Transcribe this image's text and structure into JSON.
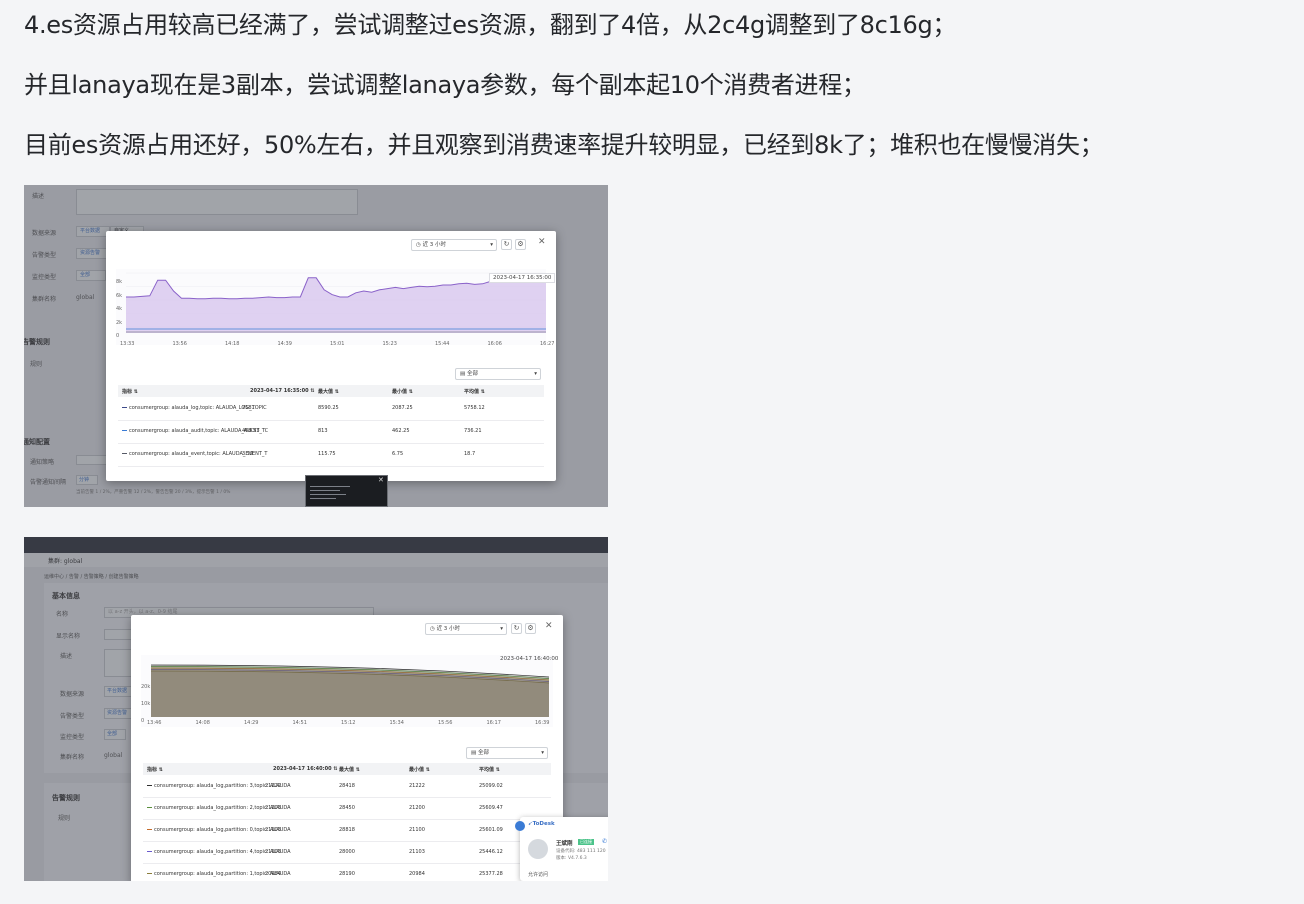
{
  "paragraphs": {
    "p1": "4.es资源占用较高已经满了，尝试调整过es资源，翻到了4倍，从2c4g调整到了8c16g；",
    "p2": "并且lanaya现在是3副本，尝试调整lanaya参数，每个副本起10个消费者进程；",
    "p3": "目前es资源占用还好，50%左右，并且观察到消费速率提升较明显，已经到8k了；堆积也在慢慢消失；"
  },
  "shot1": {
    "background_form": {
      "labels": [
        "描述",
        "数据来源",
        "告警类型",
        "监控类型",
        "集群名称"
      ],
      "values": [
        "平台数据",
        "自定义",
        "资源告警",
        "全部",
        "global"
      ],
      "section_rules": "告警规则",
      "section_rules_sub": "规则",
      "section_notify": "通知配置",
      "notify_labels": [
        "通知策略",
        "告警通知间隔"
      ],
      "notify_value": "分钟",
      "footer_note": "当前告警 1 / 2%，严重告警 12 / 2%，警告告警 20 / 3%，提示告警 1 / 0%"
    },
    "modal": {
      "time_range": "近 3 小时",
      "datetime_tag": "2023-04-17 16:35:00",
      "y_ticks": [
        "8k",
        "6k",
        "4k",
        "2k",
        "0"
      ],
      "x_ticks": [
        "13:33",
        "13:56",
        "14:18",
        "14:39",
        "15:01",
        "15:23",
        "15:44",
        "16:06",
        "16:27"
      ],
      "filter_label": "全部",
      "columns": [
        "指标",
        "2023-04-17 16:35:00",
        "最大值",
        "最小值",
        "平均值"
      ],
      "rows": [
        {
          "metric": "consumergroup: alauda_log,topic: ALAUDA_LOG_TOPIC",
          "current": "7581",
          "max": "8590.25",
          "min": "2087.25",
          "avg": "5758.12",
          "color": "#3c4a8a"
        },
        {
          "metric": "consumergroup: alauda_audit,topic: ALAUDA_AUDIT_TC",
          "current": "468.53",
          "max": "813",
          "min": "462.25",
          "avg": "736.21",
          "color": "#3a7bd5"
        },
        {
          "metric": "consumergroup: alauda_event,topic: ALAUDA_EVENT_T",
          "current": "3.19",
          "max": "115.75",
          "min": "6.75",
          "avg": "18.7",
          "color": "#555a66"
        }
      ],
      "colors": {
        "series_primary": "#8a62c9",
        "series_fill": "#d9c9ef",
        "series_secondary": "#3a7bd5"
      }
    }
  },
  "shot2": {
    "topbar": {
      "project": "集群: global"
    },
    "breadcrumb": "运维中心 / 告警 / 告警策略 / 创建告警策略",
    "background_form": {
      "section_basic": "基本信息",
      "labels": [
        "名称",
        "显示名称",
        "描述",
        "数据来源",
        "告警类型",
        "监控类型",
        "集群名称"
      ],
      "name_placeholder": "以 a-z 开头，以 a-z、0-9 结尾",
      "values": [
        "平台数据",
        "资源告警",
        "全部",
        "global"
      ],
      "section_rules": "告警规则",
      "section_rules_sub": "规则"
    },
    "modal": {
      "time_range": "近 3 小时",
      "datetime_tag": "2023-04-17 16:40:00",
      "y_ticks": [
        "20k",
        "10k",
        "0"
      ],
      "x_ticks": [
        "13:46",
        "14:08",
        "14:29",
        "14:51",
        "15:12",
        "15:34",
        "15:56",
        "16:17",
        "16:39"
      ],
      "filter_label": "全部",
      "columns": [
        "指标",
        "2023-04-17 16:40:00",
        "最大值",
        "最小值",
        "平均值"
      ],
      "rows": [
        {
          "metric": "consumergroup: alauda_log,partition: 3,topic: ALAUDA",
          "current": "21222",
          "max": "28418",
          "min": "21222",
          "avg": "25099.02",
          "color": "#2f2f2f"
        },
        {
          "metric": "consumergroup: alauda_log,partition: 2,topic: ALAUDA",
          "current": "21203",
          "max": "28450",
          "min": "21200",
          "avg": "25609.47",
          "color": "#5a8f3c"
        },
        {
          "metric": "consumergroup: alauda_log,partition: 0,topic: ALAUDA",
          "current": "21103",
          "max": "28818",
          "min": "21100",
          "avg": "25601.09",
          "color": "#c46b2b"
        },
        {
          "metric": "consumergroup: alauda_log,partition: 4,topic: ALAUDA",
          "current": "21103",
          "max": "28000",
          "min": "21103",
          "avg": "25446.12",
          "color": "#6a5acd"
        },
        {
          "metric": "consumergroup: alauda_log,partition: 1,topic: ALAUDA",
          "current": "20984",
          "max": "28190",
          "min": "20984",
          "avg": "25377.28",
          "color": "#8b7d3a"
        }
      ]
    },
    "todesk": {
      "app_name": "ToDesk",
      "user": "王斌刚",
      "status": "已连接",
      "device_line": "设备代码: 483 111 120",
      "version_line": "版本: V4.7.6.3",
      "footer": "允许访问"
    }
  }
}
